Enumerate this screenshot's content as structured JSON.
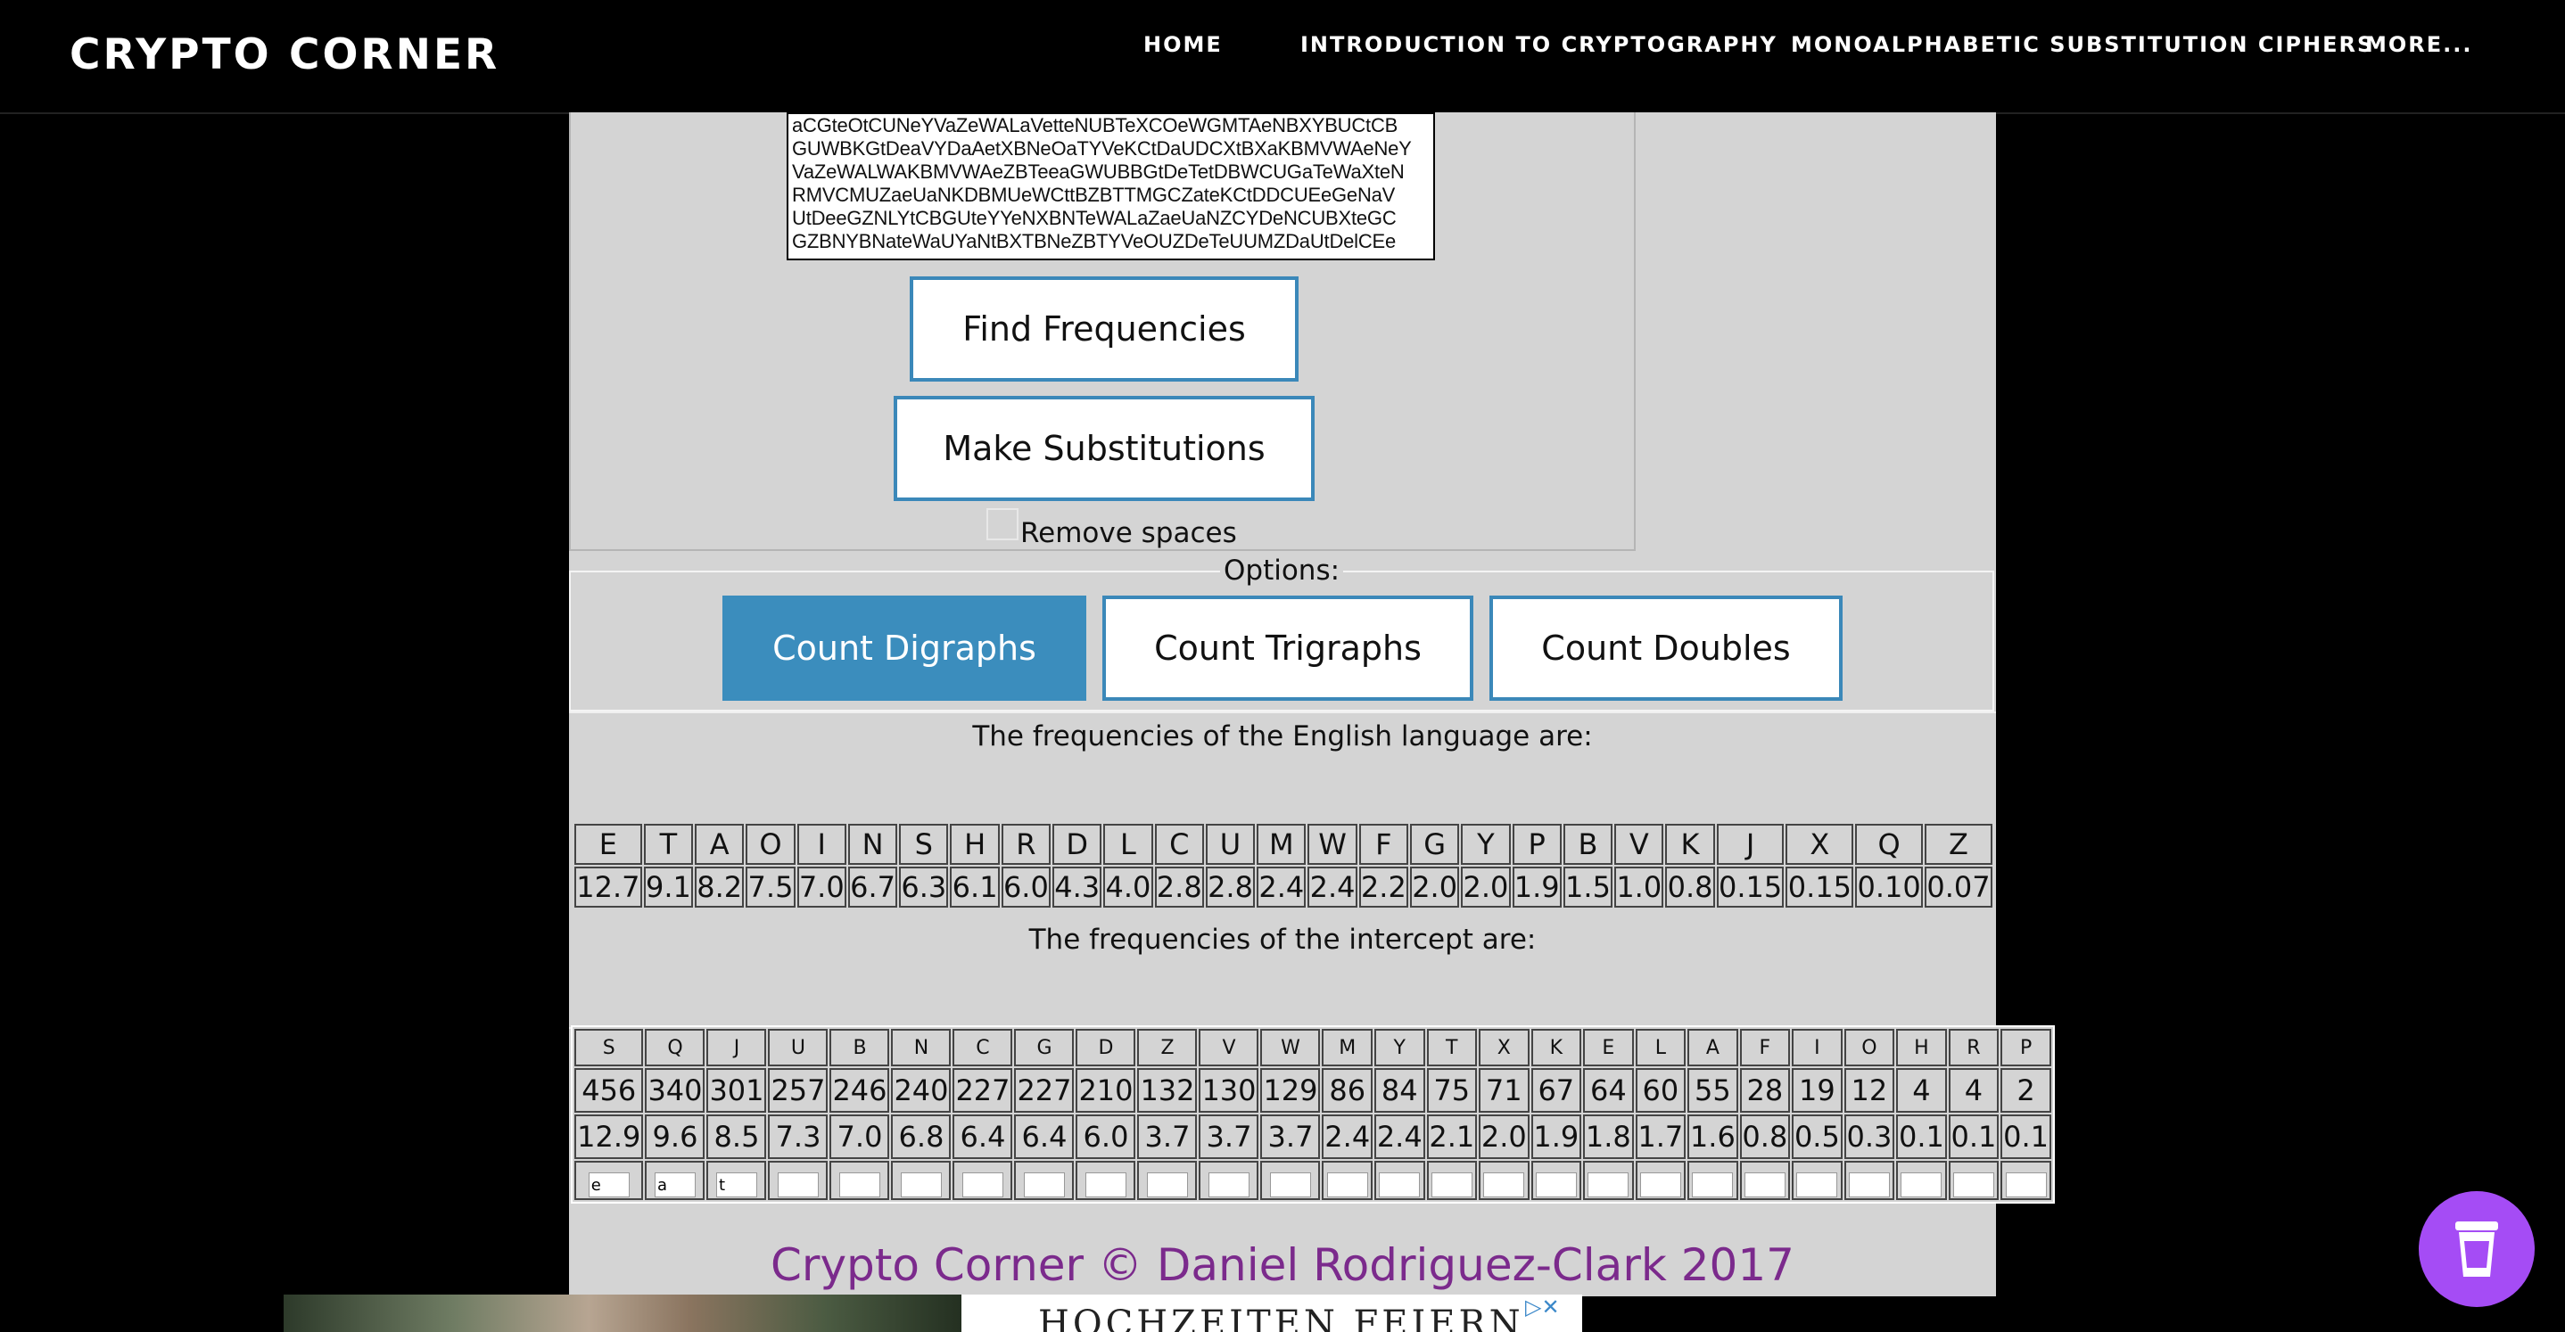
{
  "nav": {
    "brand": "CRYPTO CORNER",
    "items": [
      "HOME",
      "INTRODUCTION TO CRYPTOGRAPHY",
      "MONOALPHABETIC SUBSTITUTION CIPHERS",
      "MORE..."
    ]
  },
  "ciphertext": {
    "lines": [
      "aCGteOtCUNeYVaZeWALaVetteNUBTeXCOeWGMTAeNBXYBUCtCB",
      "GUWBKGtDeaVYDaAetXBNeOaTYVeKCtDaUDCXtBXaKBMVWAeNeY",
      "VaZeWALWAKBMVWAeZBTeeaGWUBBGtDeTetDBWCUGaTeWaXteN",
      "RMVCMUZaeUaNKDBMUeWCttBZBTTMGCZateKCtDDCUEeGeNaV",
      "UtDeeGZNLYtCBGUteYYeNXBNTeWALaZaeUaNZCYDeNCUBXteGC",
      "GZBNYBNateWaUYaNtBXTBNeZBTYVeOUZDeTeUUMZDaUtDelCEe"
    ]
  },
  "buttons": {
    "find": "Find Frequencies",
    "make": "Make Substitutions",
    "digraphs": "Count Digraphs",
    "trigraphs": "Count Trigraphs",
    "doubles": "Count Doubles"
  },
  "remove_spaces_label": "Remove spaces",
  "options_legend": "Options:",
  "english_caption": "The frequencies of the English language are:",
  "english": {
    "letters": [
      "E",
      "T",
      "A",
      "O",
      "I",
      "N",
      "S",
      "H",
      "R",
      "D",
      "L",
      "C",
      "U",
      "M",
      "W",
      "F",
      "G",
      "Y",
      "P",
      "B",
      "V",
      "K",
      "J",
      "X",
      "Q",
      "Z"
    ],
    "freqs": [
      "12.7",
      "9.1",
      "8.2",
      "7.5",
      "7.0",
      "6.7",
      "6.3",
      "6.1",
      "6.0",
      "4.3",
      "4.0",
      "2.8",
      "2.8",
      "2.4",
      "2.4",
      "2.2",
      "2.0",
      "2.0",
      "1.9",
      "1.5",
      "1.0",
      "0.8",
      "0.15",
      "0.15",
      "0.10",
      "0.07"
    ]
  },
  "intercept_caption": "The frequencies of the intercept are:",
  "intercept": {
    "letters": [
      "S",
      "Q",
      "J",
      "U",
      "B",
      "N",
      "C",
      "G",
      "D",
      "Z",
      "V",
      "W",
      "M",
      "Y",
      "T",
      "X",
      "K",
      "E",
      "L",
      "A",
      "F",
      "I",
      "O",
      "H",
      "R",
      "P"
    ],
    "counts": [
      "456",
      "340",
      "301",
      "257",
      "246",
      "240",
      "227",
      "227",
      "210",
      "132",
      "130",
      "129",
      "86",
      "84",
      "75",
      "71",
      "67",
      "64",
      "60",
      "55",
      "28",
      "19",
      "12",
      "4",
      "4",
      "2"
    ],
    "pcts": [
      "12.9",
      "9.6",
      "8.5",
      "7.3",
      "7.0",
      "6.8",
      "6.4",
      "6.4",
      "6.0",
      "3.7",
      "3.7",
      "3.7",
      "2.4",
      "2.4",
      "2.1",
      "2.0",
      "1.9",
      "1.8",
      "1.7",
      "1.6",
      "0.8",
      "0.5",
      "0.3",
      "0.1",
      "0.1",
      "0.1"
    ],
    "subs": [
      "e",
      "a",
      "t",
      "",
      "",
      "",
      "",
      "",
      "",
      "",
      "",
      "",
      "",
      "",
      "",
      "",
      "",
      "",
      "",
      "",
      "",
      "",
      "",
      "",
      "",
      ""
    ]
  },
  "footer": "Crypto Corner © Daniel Rodriguez-Clark 2017",
  "ad": {
    "headline": "HOCHZEITEN FEIERN",
    "icons": "▷✕"
  },
  "fab_icon": "cup-icon",
  "colors": {
    "accent": "#3b88b9",
    "footer": "#7b2a8c",
    "fab": "#a54cf5",
    "panel": "#d4d4d4"
  }
}
